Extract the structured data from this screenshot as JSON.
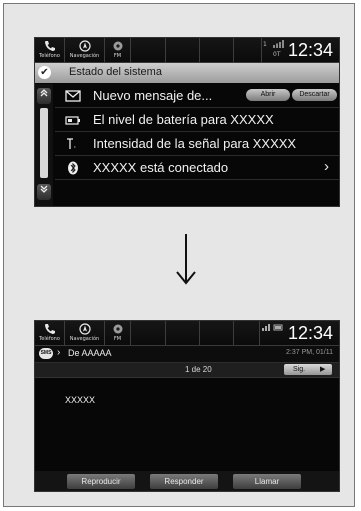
{
  "screen1": {
    "statusbar": {
      "phone_label": "Teléfono",
      "nav_label": "Navegación",
      "fm_label": "FM",
      "signal_text": "0T",
      "clock": "12:34"
    },
    "title": "Estado del sistema",
    "rows": [
      {
        "icon": "envelope-icon",
        "text": "Nuevo mensaje de...",
        "btn_open": "Abrir",
        "btn_dismiss": "Descartar"
      },
      {
        "icon": "battery-icon",
        "text": "El nivel de batería para XXXXX"
      },
      {
        "icon": "antenna-icon",
        "text": "Intensidad de la señal para XXXXX"
      },
      {
        "icon": "bluetooth-icon",
        "text": "XXXXX está conectado"
      }
    ]
  },
  "screen2": {
    "statusbar": {
      "phone_label": "Teléfono",
      "nav_label": "Navegación",
      "fm_label": "FM",
      "clock": "12:34"
    },
    "sms_badge": "SMS",
    "from": "De AAAAA",
    "timestamp": "2:37 PM, 01/11",
    "page_indicator": "1 de 20",
    "next_label": "Sig.",
    "message": "XXXXX",
    "actions": [
      "Reproducir",
      "Responder",
      "Llamar"
    ]
  },
  "colors": {
    "screen_bg": "#070707",
    "title_bar": "#b5b5b5",
    "frame_bg": "#e6e6e6"
  }
}
